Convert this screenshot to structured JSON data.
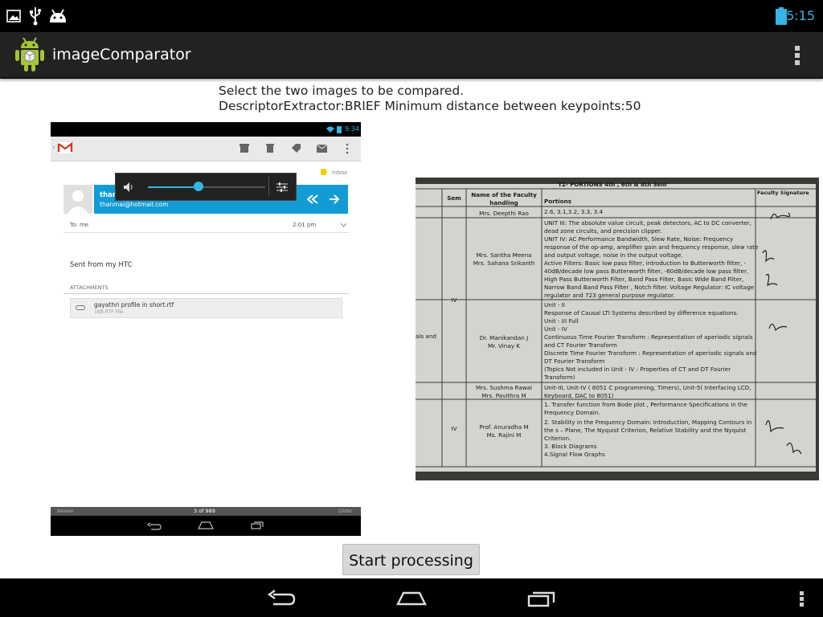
{
  "status_bar": {
    "time": "5:15",
    "left_icons": [
      "image-icon",
      "usb-icon",
      "android-debug-icon"
    ],
    "right_icons": [
      "battery-icon"
    ],
    "accent_color": "#33b5e5"
  },
  "action_bar": {
    "app_title": "imageComparator",
    "overflow_icon": "overflow-menu-icon"
  },
  "info": {
    "line1": "Select the two images to be compared.",
    "line2": "DescriptorExtractor:BRIEF Minimum distance between keypoints:50"
  },
  "left_image": {
    "status_time": "9:34",
    "inbox_label": "Inbox",
    "sender_name": "thanm",
    "sender_email": "thanmai@hotmail.com",
    "to_label": "To: me",
    "time_label": "2:01 pm",
    "body_text": "Sent from my HTC",
    "attachments_label": "ATTACHMENTS",
    "attachment_name": "gayathri profile in short.rtf",
    "attachment_meta": "1KB RTF File",
    "footer_newer": "Newer",
    "footer_count": "3 of 989",
    "footer_older": "Older",
    "volume_level": 0.43
  },
  "right_image": {
    "header_title": "T2- PORTIONS 4th , 6th & 8th Sem",
    "col_sem": "Sem",
    "col_faculty": "Name of the Faculty handling",
    "col_portions": "Portions",
    "col_signature": "Faculty Signature",
    "rows": [
      {
        "sem": "",
        "faculty": "Mrs. Deepthi Rao",
        "portions": [
          "2.6, 3.1,3.2, 3.3, 3.4"
        ]
      },
      {
        "sem": "",
        "faculty": "Mrs. Santha Meena\nMrs. Sahana Srikanth",
        "portions": [
          "UNIT III: The absolute value circuit, peak detectors, AC to DC converter,",
          "dead zone circuits, and precision clipper.",
          "UNIT IV: AC Performance Bandwidth, Slew Rate, Noise: Frequency",
          "response of the op-amp, amplifier gain and frequency response, slew rate",
          "and output voltage, noise in the output voltage.",
          "Active Filters: Basic low pass filter, introduction to Butterworth filter, -",
          "40dB/decade low pass Butterworth filter, -60dB/decade low pass filter,",
          "High Pass Butterworth Filter, Band Pass Filter, Basic Wide Band Filter,",
          "Narrow Band Band Pass Filter , Notch filter. Voltage Regulator: IC voltage",
          "regulator and 723 general purpose regulator."
        ]
      },
      {
        "sem": "IV",
        "faculty": "Dr. Manikandan J\nMr. Vinay K",
        "portions": [
          "Unit - II",
          "Response of Causal LTI Systems described by difference equations.",
          "Unit - III Full",
          "Unit - IV",
          "Continuous Time Fourier Transform : Representation of aperiodic signals",
          "and CT Fourier Transform",
          "Discrete Time Fourier Transform : Representation of aperiodic signals and",
          "DT Fourier Transform",
          "(Topics Not included in Unit - IV : Properties of CT and DT Fourier",
          "Transform)"
        ]
      },
      {
        "sem": "",
        "faculty": "Mrs. Sushma Rawal\nMrs. Pavithra M",
        "portions": [
          "Unit-III, Unit-IV ( 8051 C programming, Timers), Unit-5( Interfacing LCD,",
          "Keyboard, DAC to 8051)"
        ]
      },
      {
        "sem": "IV",
        "faculty": "Prof. Anuradha M\nMs. Rajini M",
        "portions": [
          "1. Transfer function from Bode plot , Performance Specifications in the",
          "Frequency Domain.",
          "2. Stability in the Frequency Domain: Introduction, Mapping Contours in",
          "the s – Plane, The Nyquist Criterion, Relative Stability and the Nyquist",
          "Criterion.",
          "3. Block Diagrams",
          "4.Signal Flow Graphs"
        ]
      }
    ],
    "left_partial_text": "als and"
  },
  "start_button": {
    "label": "Start processing"
  },
  "nav_bar": {
    "icons": [
      "back-icon",
      "home-icon",
      "recents-icon",
      "overflow-menu-icon"
    ]
  }
}
